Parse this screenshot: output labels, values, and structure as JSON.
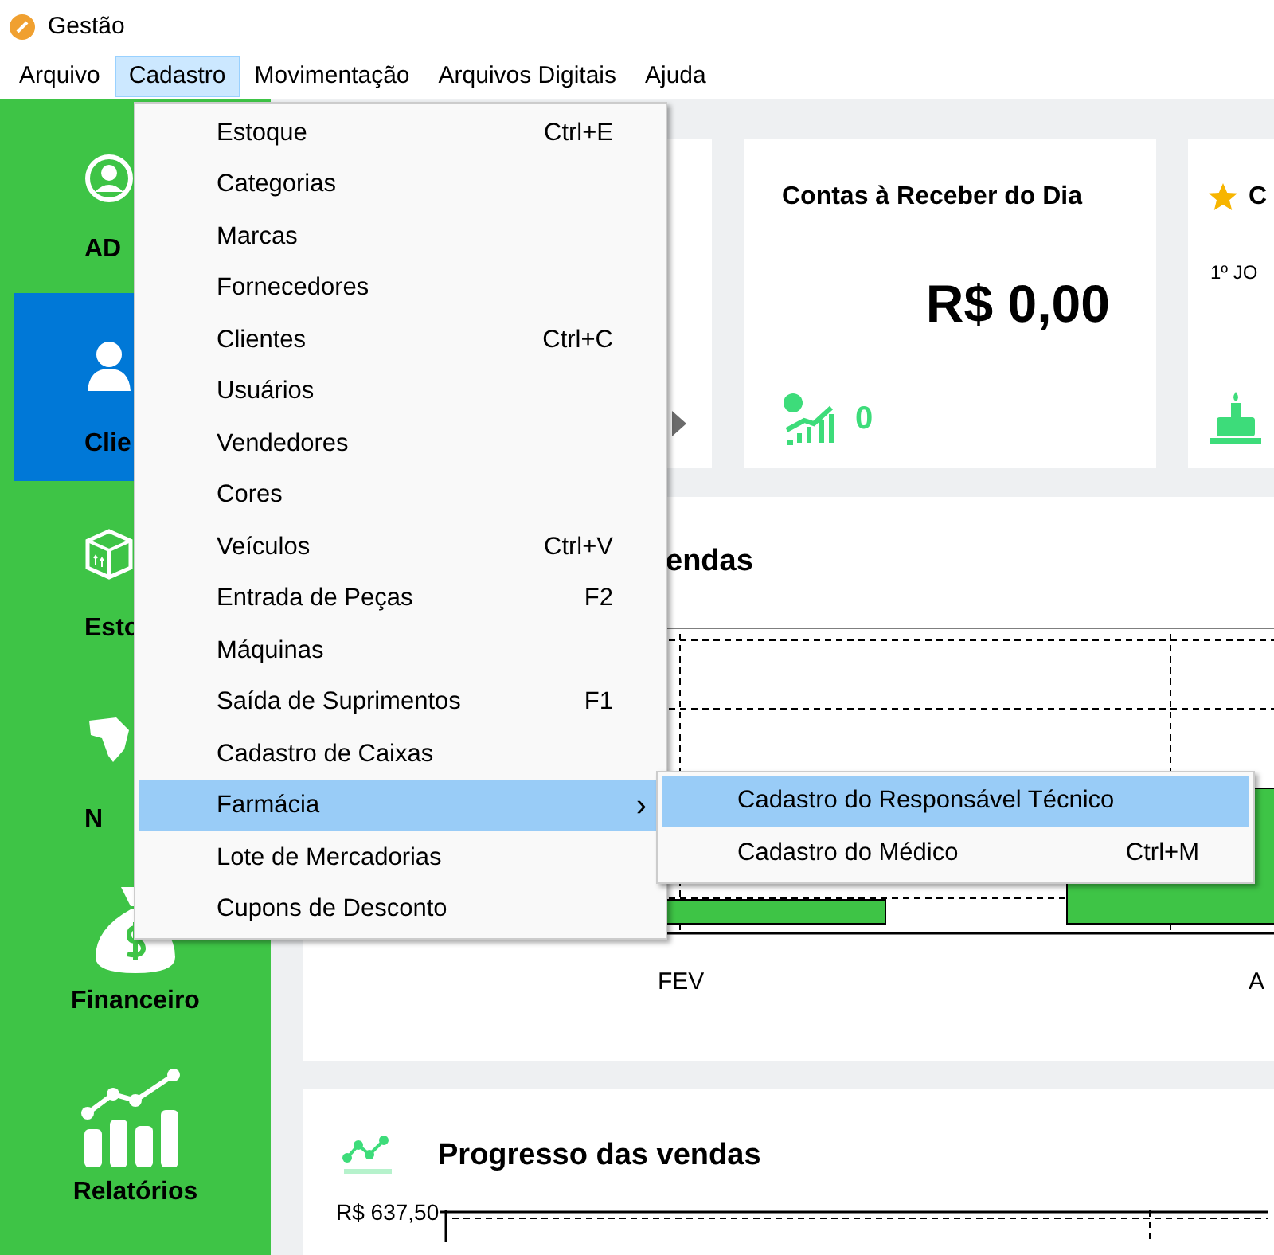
{
  "window": {
    "title": "Gestão"
  },
  "menubar": [
    {
      "label": "Arquivo",
      "selected": false
    },
    {
      "label": "Cadastro",
      "selected": true
    },
    {
      "label": "Movimentação",
      "selected": false
    },
    {
      "label": "Arquivos Digitais",
      "selected": false
    },
    {
      "label": "Ajuda",
      "selected": false
    }
  ],
  "sidebar": {
    "items": [
      {
        "kind": "admin",
        "label": "AD",
        "selected": false
      },
      {
        "kind": "clients",
        "label": "Clie",
        "selected": true
      },
      {
        "kind": "stock",
        "label": "Esto",
        "selected": false
      },
      {
        "kind": "nf",
        "label": "N",
        "selected": false
      },
      {
        "kind": "finance",
        "label": "Financeiro",
        "selected": false
      },
      {
        "kind": "reports",
        "label": "Relatórios",
        "selected": false
      }
    ]
  },
  "cards": [
    {
      "kind": "receivable",
      "title": "Contas à Receber do Dia",
      "value": "R$ 0,00",
      "count": "0"
    },
    {
      "kind": "birthdays",
      "title": "C",
      "line": "1º JO"
    }
  ],
  "sales_chart": {
    "title": "endas",
    "x_labels": [
      "FEV",
      "A"
    ]
  },
  "progress_chart": {
    "title": "Progresso das vendas",
    "y_label": "R$ 637,50"
  },
  "dropdown": {
    "items": [
      {
        "label": "Estoque",
        "shortcut": "Ctrl+E",
        "selected": false
      },
      {
        "label": "Categorias",
        "selected": false
      },
      {
        "label": "Marcas",
        "selected": false
      },
      {
        "label": "Fornecedores",
        "selected": false
      },
      {
        "label": "Clientes",
        "shortcut": "Ctrl+C",
        "selected": false
      },
      {
        "label": "Usuários",
        "selected": false
      },
      {
        "label": "Vendedores",
        "selected": false
      },
      {
        "label": "Cores",
        "selected": false
      },
      {
        "label": "Veículos",
        "shortcut": "Ctrl+V",
        "selected": false
      },
      {
        "label": "Entrada de Peças",
        "shortcut": "F2",
        "selected": false
      },
      {
        "label": "Máquinas",
        "selected": false
      },
      {
        "label": "Saída de Suprimentos",
        "shortcut": "F1",
        "selected": false
      },
      {
        "label": "Cadastro de Caixas",
        "selected": false
      },
      {
        "label": "Farmácia",
        "submenu_arrow": "›",
        "selected": true,
        "children": [
          {
            "label": "Cadastro do Responsável Técnico",
            "selected": true
          },
          {
            "label": "Cadastro do Médico",
            "shortcut": "Ctrl+M",
            "selected": false
          }
        ]
      },
      {
        "label": "Lote de Mercadorias",
        "selected": false
      },
      {
        "label": "Cupons de Desconto",
        "selected": false
      }
    ]
  }
}
